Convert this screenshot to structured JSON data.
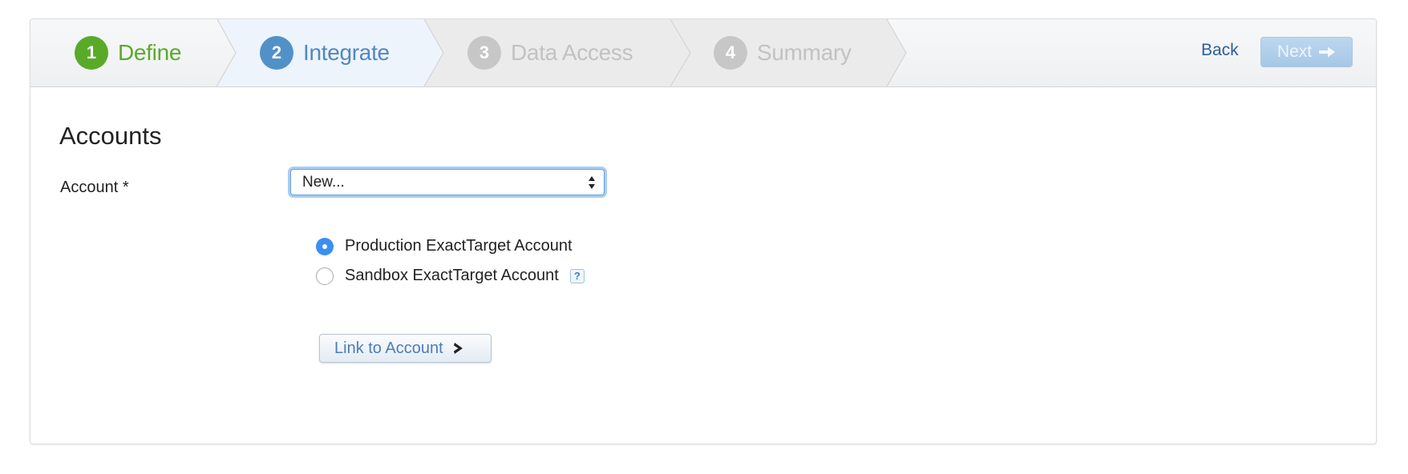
{
  "wizard": {
    "steps": [
      {
        "number": "1",
        "label": "Define",
        "state": "done"
      },
      {
        "number": "2",
        "label": "Integrate",
        "state": "active"
      },
      {
        "number": "3",
        "label": "Data Access",
        "state": "todo"
      },
      {
        "number": "4",
        "label": "Summary",
        "state": "todo"
      }
    ],
    "back_label": "Back",
    "next_label": "Next",
    "next_icon": "arrow-right-icon"
  },
  "section": {
    "title": "Accounts"
  },
  "account_field": {
    "label": "Account *",
    "selected_value": "New...",
    "icon": "updown-arrows-icon"
  },
  "account_type": {
    "options": [
      {
        "label": "Production ExactTarget Account",
        "checked": true
      },
      {
        "label": "Sandbox ExactTarget Account",
        "checked": false
      }
    ],
    "help_glyph": "?"
  },
  "link_button": {
    "label": "Link to Account",
    "icon": "chevron-right-icon"
  },
  "colors": {
    "done": "#5aaa2a",
    "active": "#5291c8",
    "todo": "#c7c7c7",
    "radio_selected": "#3b8ff0"
  }
}
